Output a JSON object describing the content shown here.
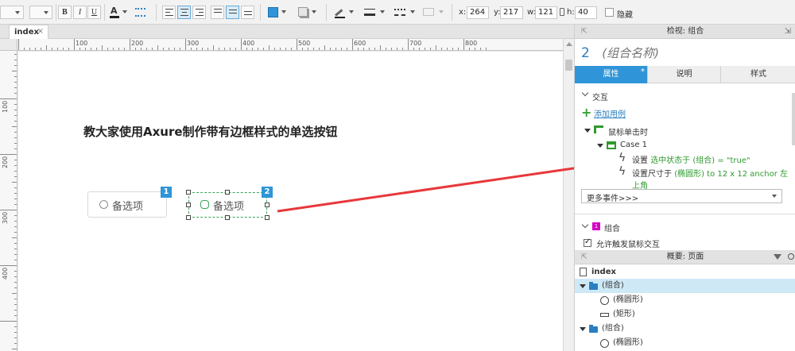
{
  "toolbar": {
    "font_size_value": "",
    "bold_label": "B",
    "italic_label": "I",
    "underline_label": "U",
    "font_color_label": "A",
    "x_label": "x:",
    "x_value": "264",
    "y_label": "y:",
    "y_value": "217",
    "w_label": "w:",
    "w_value": "121",
    "h_label": "h:",
    "h_value": "40",
    "hide_label": "隐藏",
    "accent_color": "#2f95d8"
  },
  "tabs": [
    {
      "label": "index",
      "close": "×"
    }
  ],
  "ruler": {
    "h_numbers": [
      "100",
      "200",
      "300",
      "400",
      "500",
      "600",
      "700",
      "800"
    ],
    "v_numbers": [
      "100",
      "200",
      "300",
      "400"
    ]
  },
  "canvas": {
    "heading": "教大家使用Axure制作带有边框样式的单选按钮",
    "radio1": {
      "label": "备选项",
      "badge": "1"
    },
    "radio2": {
      "label": "备选项",
      "badge": "2"
    },
    "arrow_color": "#e8373a",
    "selection_color": "#3aa35b"
  },
  "inspector": {
    "header": "检视: 组合",
    "object_number": "2",
    "object_name": "(组合名称)",
    "tabs": [
      {
        "label": "属性",
        "active": true
      },
      {
        "label": "说明",
        "active": false
      },
      {
        "label": "样式",
        "active": false
      }
    ],
    "interaction_section": "交互",
    "add_case_label": "添加用例",
    "event_label": "鼠标单击时",
    "case_label": "Case 1",
    "action1_prefix": "设置",
    "action1_detail": "选中状态于 (组合) = \"true\"",
    "action2_prefix": "设置尺寸于",
    "action2_detail": "(椭圆形) to 12 x 12 anchor 左上角",
    "more_events": "更多事件>>>",
    "group_section": "组合",
    "group_badge": "1",
    "allow_trigger_label": "允许触发鼠标交互"
  },
  "outline": {
    "header": "概要: 页面",
    "page_name": "index",
    "items": [
      {
        "label": "(组合)",
        "kind": "folder",
        "selected": true
      },
      {
        "label": "(椭圆形)",
        "kind": "ellipse",
        "selected": false
      },
      {
        "label": "(矩形)",
        "kind": "rect",
        "selected": false
      },
      {
        "label": "(组合)",
        "kind": "folder",
        "selected": false
      },
      {
        "label": "(椭圆形)",
        "kind": "ellipse",
        "selected": false
      }
    ]
  }
}
